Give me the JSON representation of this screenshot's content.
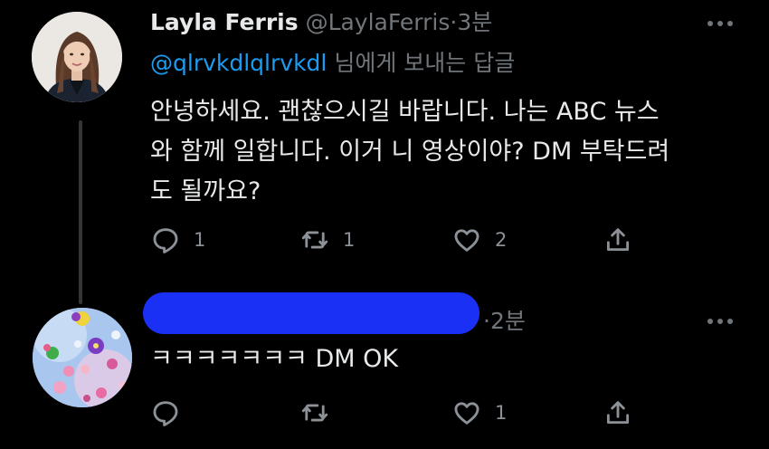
{
  "tweet": {
    "author_name": "Layla Ferris",
    "author_handle": "@LaylaFerris",
    "separator": "·",
    "time": "3분",
    "replying_to_handle": "@qlrvkdlqlrvkdl",
    "replying_suffix": " 님에게 보내는 답글",
    "text": "안녕하세요. 괜찮으시길 바랍니다. 나는 ABC 뉴스\n와 함께 일합니다. 이거 니 영상이야? DM 부탁드려\n도 될까요?",
    "replies": "1",
    "retweets": "1",
    "likes": "2"
  },
  "reply": {
    "separator": "·",
    "time": "2분",
    "text": "ㅋㅋㅋㅋㅋㅋㅋ DM OK",
    "replies": "",
    "retweets": "",
    "likes": "1"
  },
  "icons": {
    "reply": "speech-bubble-icon",
    "retweet": "retweet-icon",
    "like": "heart-icon",
    "share": "share-icon",
    "more": "more-dots-icon"
  },
  "colors": {
    "background": "#000000",
    "primary_text": "#e7e9ea",
    "secondary_text": "#71767b",
    "link": "#1d9bf0",
    "redaction": "#1a30f5"
  }
}
